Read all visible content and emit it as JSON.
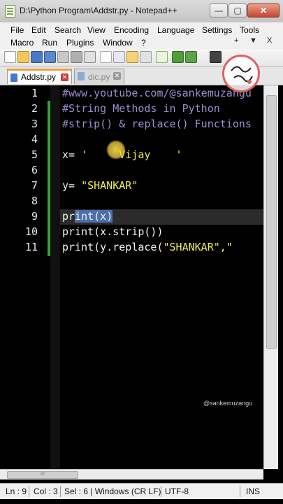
{
  "window": {
    "title": "D:\\Python Program\\Addstr.py - Notepad++",
    "min_label": "—",
    "max_label": "▢",
    "close_label": "✕"
  },
  "menu": {
    "row1": [
      "File",
      "Edit",
      "Search",
      "View",
      "Encoding",
      "Language",
      "Settings",
      "Tools"
    ],
    "row2": [
      "Macro",
      "Run",
      "Plugins",
      "Window",
      "?"
    ],
    "extra": [
      "+",
      "▼",
      "X"
    ]
  },
  "tabs": [
    {
      "label": "Addstr.py",
      "active": true
    },
    {
      "label": "dic.py",
      "active": false
    }
  ],
  "editor": {
    "line_numbers": [
      "1",
      "2",
      "3",
      "4",
      "5",
      "6",
      "7",
      "8",
      "9",
      "10",
      "11"
    ],
    "lines": [
      {
        "n": 1,
        "text": "#www.youtube.com/@sankemuzangu"
      },
      {
        "n": 2,
        "text": "#String Methods in Python"
      },
      {
        "n": 3,
        "text": "#strip() & replace() Functions"
      },
      {
        "n": 5,
        "pre": "x= ",
        "str": "'     Vijay    '"
      },
      {
        "n": 7,
        "pre": "y= ",
        "str": "\"SHANKAR\""
      },
      {
        "n": 9,
        "pre": "pr",
        "sel": "int(x)"
      },
      {
        "n": 10,
        "text": "print(x.strip())"
      },
      {
        "n": 11,
        "pre": "print(y.replace(",
        "str": "\"SHANKAR\",\""
      }
    ],
    "colors": {
      "comment": "#9a8fcf",
      "string": "#f0f050",
      "default": "#f2f2f2",
      "selection": "#4b6fa8",
      "change_marker": "#3aa03a"
    }
  },
  "watermark": "@sankemuzangu",
  "status": {
    "ln": "Ln : 9",
    "col": "Col : 3",
    "sel": "Sel : 6 | Windows (CR LF)",
    "encoding": "UTF-8",
    "mode": "INS"
  },
  "scroll": {
    "hscroll_grip": "III"
  }
}
